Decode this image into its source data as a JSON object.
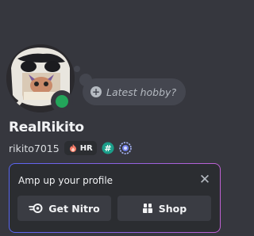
{
  "profile": {
    "display_name": "RealRikito",
    "username": "rikito7015",
    "status_placeholder": "Latest hobby?",
    "clan_tag": "HR",
    "online_status": "online",
    "badges": [
      "hypesquad-badge",
      "nitro-badge"
    ]
  },
  "promo": {
    "title": "Amp up your profile",
    "nitro_label": "Get Nitro",
    "shop_label": "Shop",
    "close_label": "✕"
  },
  "colors": {
    "background": "#36373e",
    "card": "#2b2d31",
    "button": "#3a3c43",
    "status_online": "#23a55a",
    "gradient_start": "#5865f2",
    "gradient_end": "#c061d4"
  }
}
